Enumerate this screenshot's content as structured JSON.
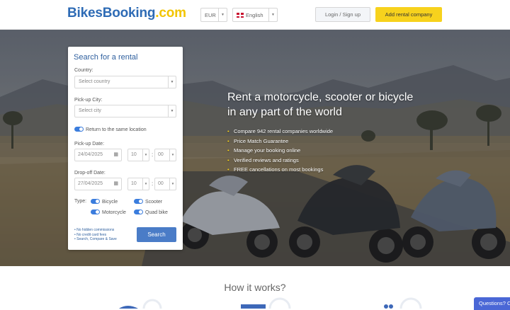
{
  "header": {
    "logo_part1": "BikesBooking",
    "logo_part2": ".com",
    "currency": "EUR",
    "language": "English",
    "login_label": "Login / Sign up",
    "add_company_label": "Add rental company"
  },
  "hero": {
    "title_line1": "Rent a motorcycle, scooter or bicycle",
    "title_line2": "in any part of the world",
    "features": [
      "Compare 942 rental companies worldwide",
      "Price Match Guarantee",
      "Manage your booking online",
      "Verified reviews and ratings",
      "FREE cancellations on most bookings"
    ]
  },
  "search": {
    "title": "Search for a rental",
    "country_label": "Country:",
    "country_placeholder": "Select country",
    "city_label": "Pick-up City:",
    "city_placeholder": "Select city",
    "return_same_label": "Return to the same location",
    "pickup_date_label": "Pick-up Date:",
    "pickup_date": "24/04/2025",
    "pickup_hour": "10",
    "pickup_minute": "00",
    "dropoff_date_label": "Drop-off Date:",
    "dropoff_date": "27/04/2025",
    "dropoff_hour": "10",
    "dropoff_minute": "00",
    "type_label": "Type:",
    "types": [
      "Bicycle",
      "Scooter",
      "Motorcycle",
      "Quad bike"
    ],
    "notes": [
      "No hidden commissions",
      "No credit card fees",
      "Search, Compare & Save"
    ],
    "search_button": "Search"
  },
  "how_it_works": {
    "title": "How it works?"
  },
  "help": {
    "label": "Questions? C"
  },
  "colors": {
    "brand_blue": "#2e6bb5",
    "brand_yellow": "#f7d21d",
    "button_blue": "#4a7cc7"
  }
}
